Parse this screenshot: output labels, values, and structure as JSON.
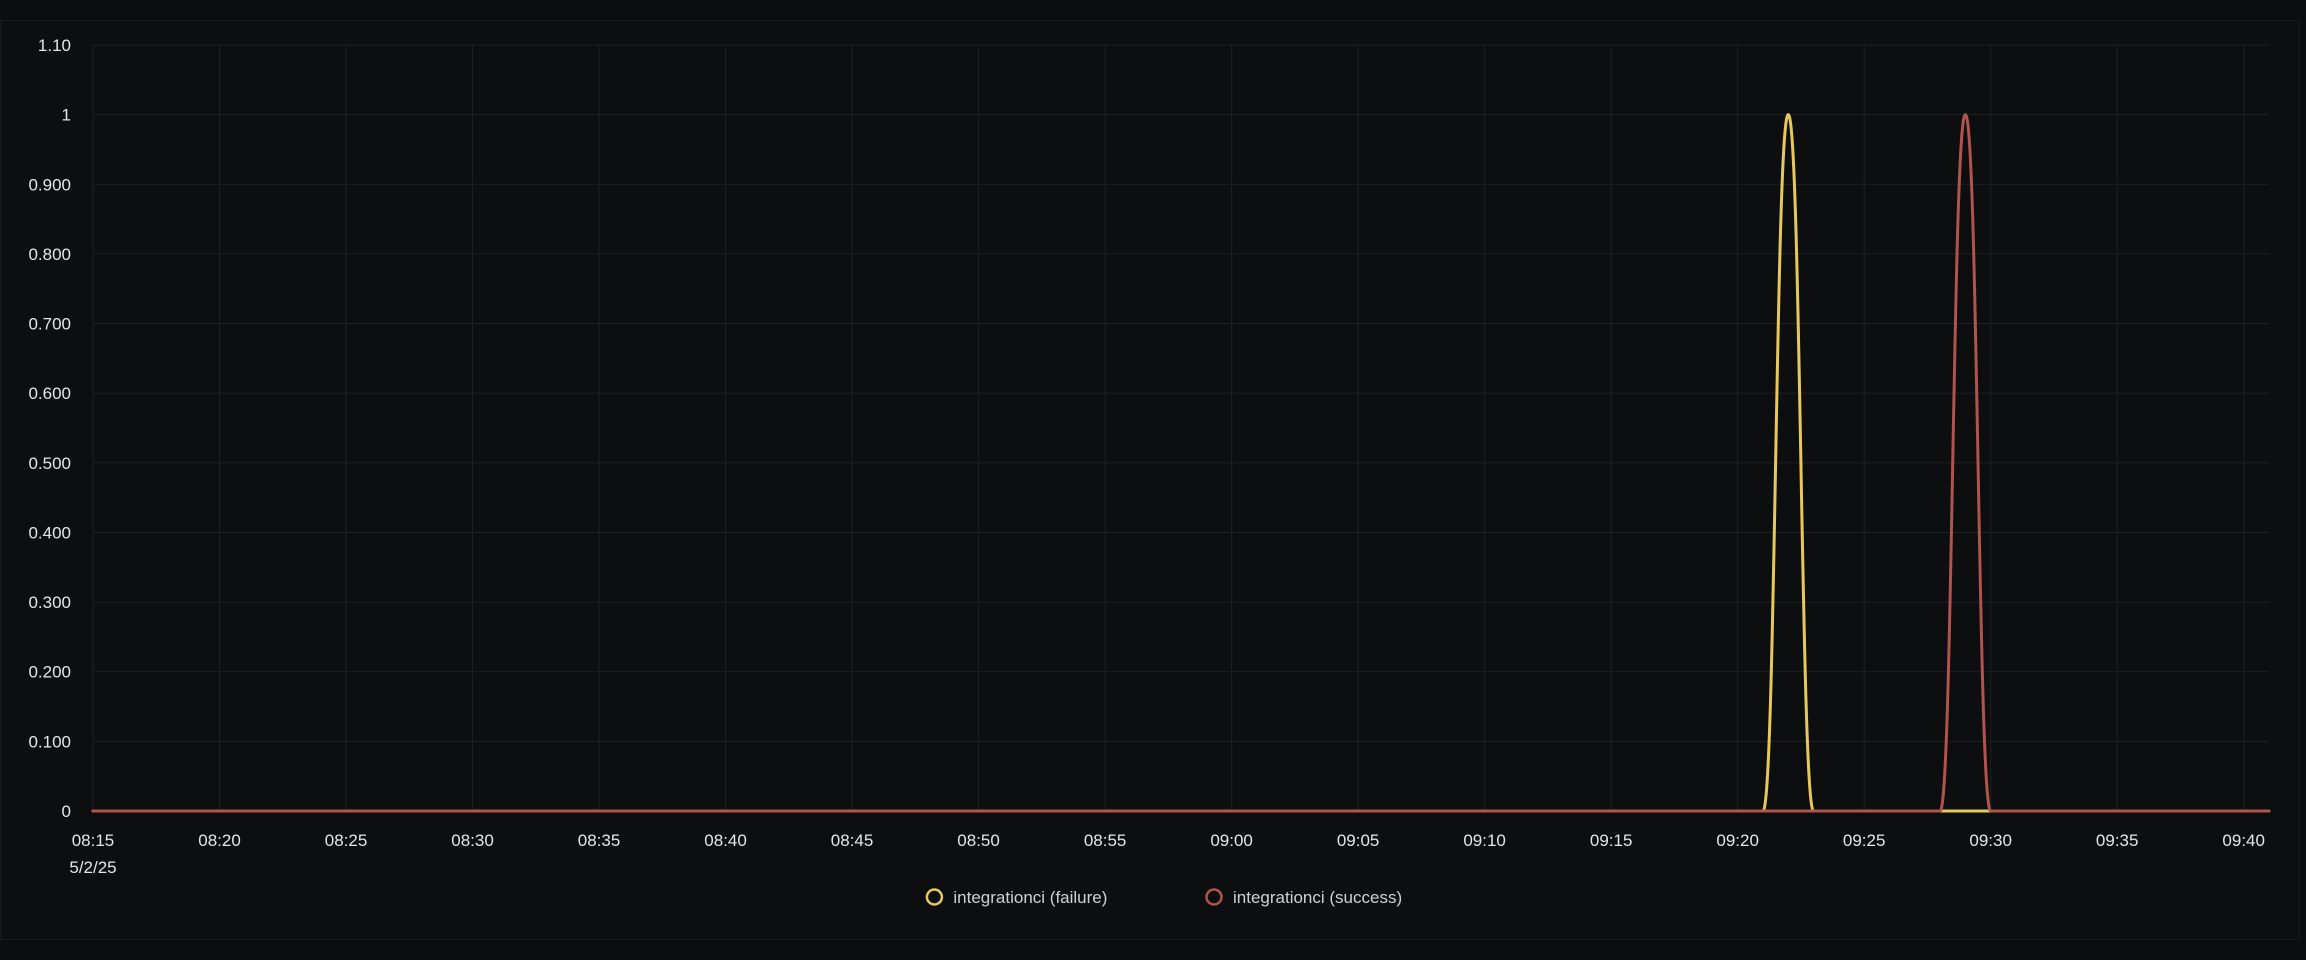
{
  "chart_data": {
    "type": "line",
    "title": "",
    "xlabel": "",
    "ylabel": "",
    "x_date_label": "5/2/25",
    "x_ticks": [
      "08:15",
      "08:20",
      "08:25",
      "08:30",
      "08:35",
      "08:40",
      "08:45",
      "08:50",
      "08:55",
      "09:00",
      "09:05",
      "09:10",
      "09:15",
      "09:20",
      "09:25",
      "09:30",
      "09:35",
      "09:40"
    ],
    "y_ticks": [
      "0",
      "0.100",
      "0.200",
      "0.300",
      "0.400",
      "0.500",
      "0.600",
      "0.700",
      "0.800",
      "0.900",
      "1",
      "1.10"
    ],
    "ylim": [
      0,
      1.1
    ],
    "xlim": [
      "08:15",
      "09:41"
    ],
    "grid": true,
    "legend_position": "bottom-center",
    "series": [
      {
        "name": "integrationci (failure)",
        "color": "#e8c85a",
        "points": [
          {
            "x": "08:15",
            "y": 0
          },
          {
            "x": "09:21",
            "y": 0
          },
          {
            "x": "09:22",
            "y": 1
          },
          {
            "x": "09:23",
            "y": 0
          },
          {
            "x": "09:41",
            "y": 0
          }
        ]
      },
      {
        "name": "integrationci (success)",
        "color": "#b0544d",
        "points": [
          {
            "x": "08:15",
            "y": 0
          },
          {
            "x": "09:28",
            "y": 0
          },
          {
            "x": "09:29",
            "y": 1
          },
          {
            "x": "09:30",
            "y": 0
          },
          {
            "x": "09:41",
            "y": 0
          }
        ]
      }
    ]
  }
}
